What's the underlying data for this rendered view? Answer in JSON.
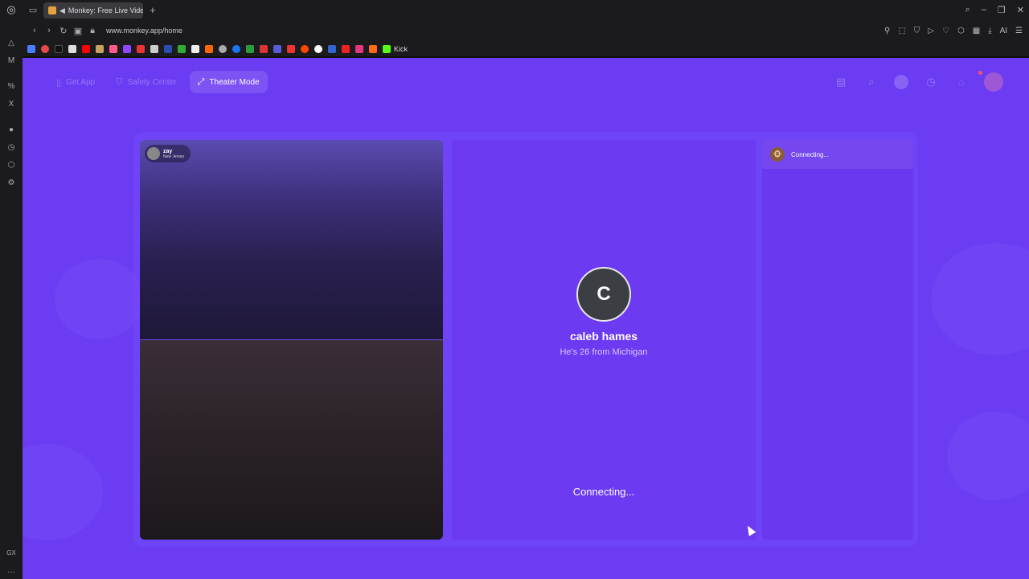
{
  "browser": {
    "tab_title": "Monkey: Free Live Vide",
    "url": "www.monkey.app/home",
    "bookmark_kick": "Kick",
    "sidebar_gx": "GX"
  },
  "page": {
    "nav": {
      "get_app": "Get App",
      "safety_center": "Safety Center",
      "theater_mode": "Theater Mode"
    },
    "self_video": {
      "name": "zay",
      "location": "New Jersey"
    },
    "match": {
      "initial": "C",
      "name": "caleb hames",
      "subtitle": "He's 26 from Michigan",
      "status": "Connecting..."
    },
    "side_status": "Connecting..."
  }
}
